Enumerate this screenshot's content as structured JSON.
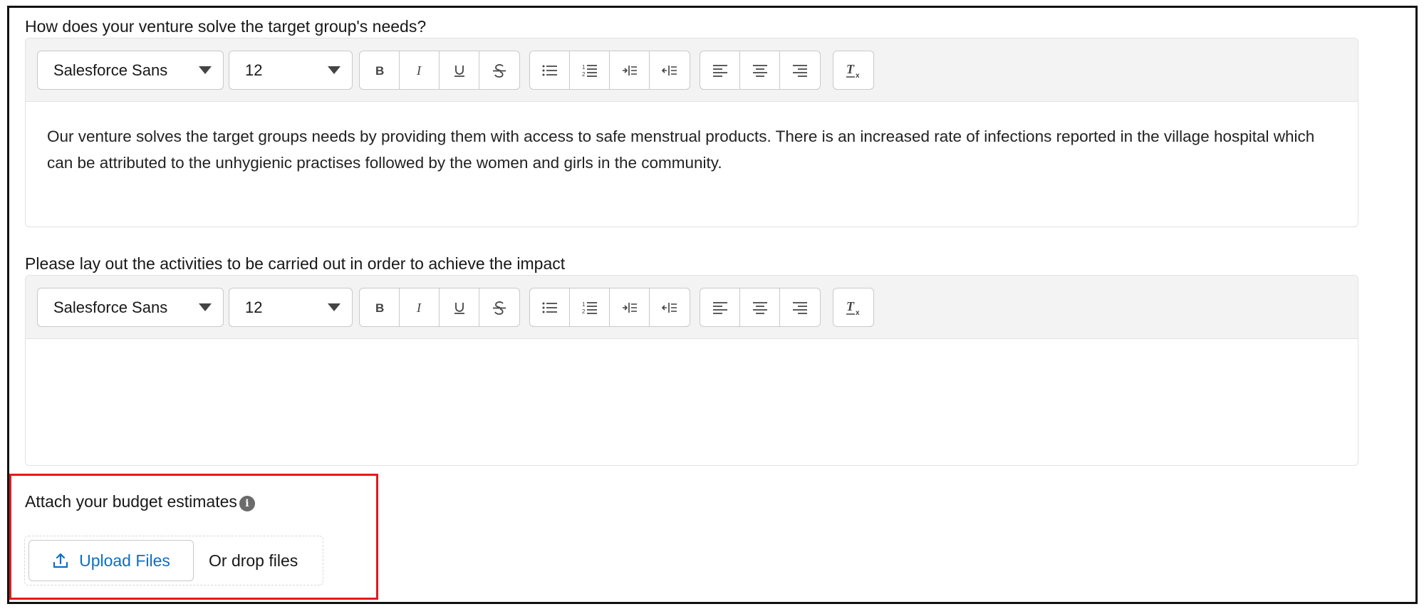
{
  "editors": [
    {
      "question": "How does your venture solve the target group's needs?",
      "font_family": "Salesforce Sans",
      "font_size": "12",
      "content": "Our venture solves the target groups needs by providing them with access to safe menstrual products. There is an increased rate of infections reported in the village hospital which can be attributed to the unhygienic practises followed by the women and girls in the community."
    },
    {
      "question": "Please lay out the activities to be carried out in order to achieve the impact",
      "font_family": "Salesforce Sans",
      "font_size": "12",
      "content": ""
    }
  ],
  "toolbar_icons": {
    "format": [
      "bold-icon",
      "italic-icon",
      "underline-icon",
      "strikethrough-icon"
    ],
    "lists": [
      "bullet-list-icon",
      "numbered-list-icon",
      "indent-icon",
      "outdent-icon"
    ],
    "align": [
      "align-left-icon",
      "align-center-icon",
      "align-right-icon"
    ],
    "clear": [
      "clear-formatting-icon"
    ]
  },
  "attachment": {
    "label": "Attach your budget estimates",
    "info_icon": "info-icon",
    "upload_button": "Upload Files",
    "drop_text": "Or drop files",
    "upload_icon": "upload-icon"
  },
  "colors": {
    "highlight": "#e31b1b",
    "link_blue": "#0b6fc6",
    "toolbar_bg": "#f3f3f3"
  }
}
